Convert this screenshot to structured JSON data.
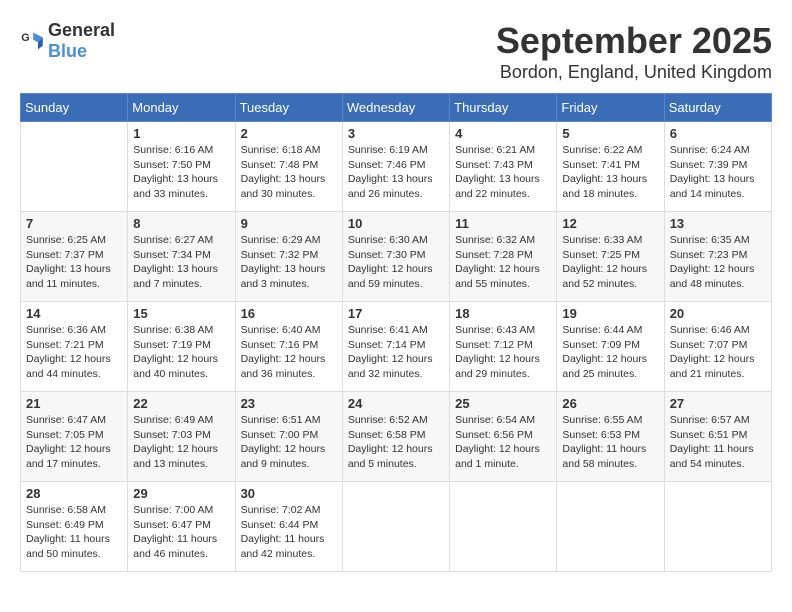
{
  "header": {
    "logo_general": "General",
    "logo_blue": "Blue",
    "month": "September 2025",
    "location": "Bordon, England, United Kingdom"
  },
  "days_of_week": [
    "Sunday",
    "Monday",
    "Tuesday",
    "Wednesday",
    "Thursday",
    "Friday",
    "Saturday"
  ],
  "weeks": [
    [
      {
        "day": "",
        "info": ""
      },
      {
        "day": "1",
        "info": "Sunrise: 6:16 AM\nSunset: 7:50 PM\nDaylight: 13 hours\nand 33 minutes."
      },
      {
        "day": "2",
        "info": "Sunrise: 6:18 AM\nSunset: 7:48 PM\nDaylight: 13 hours\nand 30 minutes."
      },
      {
        "day": "3",
        "info": "Sunrise: 6:19 AM\nSunset: 7:46 PM\nDaylight: 13 hours\nand 26 minutes."
      },
      {
        "day": "4",
        "info": "Sunrise: 6:21 AM\nSunset: 7:43 PM\nDaylight: 13 hours\nand 22 minutes."
      },
      {
        "day": "5",
        "info": "Sunrise: 6:22 AM\nSunset: 7:41 PM\nDaylight: 13 hours\nand 18 minutes."
      },
      {
        "day": "6",
        "info": "Sunrise: 6:24 AM\nSunset: 7:39 PM\nDaylight: 13 hours\nand 14 minutes."
      }
    ],
    [
      {
        "day": "7",
        "info": "Sunrise: 6:25 AM\nSunset: 7:37 PM\nDaylight: 13 hours\nand 11 minutes."
      },
      {
        "day": "8",
        "info": "Sunrise: 6:27 AM\nSunset: 7:34 PM\nDaylight: 13 hours\nand 7 minutes."
      },
      {
        "day": "9",
        "info": "Sunrise: 6:29 AM\nSunset: 7:32 PM\nDaylight: 13 hours\nand 3 minutes."
      },
      {
        "day": "10",
        "info": "Sunrise: 6:30 AM\nSunset: 7:30 PM\nDaylight: 12 hours\nand 59 minutes."
      },
      {
        "day": "11",
        "info": "Sunrise: 6:32 AM\nSunset: 7:28 PM\nDaylight: 12 hours\nand 55 minutes."
      },
      {
        "day": "12",
        "info": "Sunrise: 6:33 AM\nSunset: 7:25 PM\nDaylight: 12 hours\nand 52 minutes."
      },
      {
        "day": "13",
        "info": "Sunrise: 6:35 AM\nSunset: 7:23 PM\nDaylight: 12 hours\nand 48 minutes."
      }
    ],
    [
      {
        "day": "14",
        "info": "Sunrise: 6:36 AM\nSunset: 7:21 PM\nDaylight: 12 hours\nand 44 minutes."
      },
      {
        "day": "15",
        "info": "Sunrise: 6:38 AM\nSunset: 7:19 PM\nDaylight: 12 hours\nand 40 minutes."
      },
      {
        "day": "16",
        "info": "Sunrise: 6:40 AM\nSunset: 7:16 PM\nDaylight: 12 hours\nand 36 minutes."
      },
      {
        "day": "17",
        "info": "Sunrise: 6:41 AM\nSunset: 7:14 PM\nDaylight: 12 hours\nand 32 minutes."
      },
      {
        "day": "18",
        "info": "Sunrise: 6:43 AM\nSunset: 7:12 PM\nDaylight: 12 hours\nand 29 minutes."
      },
      {
        "day": "19",
        "info": "Sunrise: 6:44 AM\nSunset: 7:09 PM\nDaylight: 12 hours\nand 25 minutes."
      },
      {
        "day": "20",
        "info": "Sunrise: 6:46 AM\nSunset: 7:07 PM\nDaylight: 12 hours\nand 21 minutes."
      }
    ],
    [
      {
        "day": "21",
        "info": "Sunrise: 6:47 AM\nSunset: 7:05 PM\nDaylight: 12 hours\nand 17 minutes."
      },
      {
        "day": "22",
        "info": "Sunrise: 6:49 AM\nSunset: 7:03 PM\nDaylight: 12 hours\nand 13 minutes."
      },
      {
        "day": "23",
        "info": "Sunrise: 6:51 AM\nSunset: 7:00 PM\nDaylight: 12 hours\nand 9 minutes."
      },
      {
        "day": "24",
        "info": "Sunrise: 6:52 AM\nSunset: 6:58 PM\nDaylight: 12 hours\nand 5 minutes."
      },
      {
        "day": "25",
        "info": "Sunrise: 6:54 AM\nSunset: 6:56 PM\nDaylight: 12 hours\nand 1 minute."
      },
      {
        "day": "26",
        "info": "Sunrise: 6:55 AM\nSunset: 6:53 PM\nDaylight: 11 hours\nand 58 minutes."
      },
      {
        "day": "27",
        "info": "Sunrise: 6:57 AM\nSunset: 6:51 PM\nDaylight: 11 hours\nand 54 minutes."
      }
    ],
    [
      {
        "day": "28",
        "info": "Sunrise: 6:58 AM\nSunset: 6:49 PM\nDaylight: 11 hours\nand 50 minutes."
      },
      {
        "day": "29",
        "info": "Sunrise: 7:00 AM\nSunset: 6:47 PM\nDaylight: 11 hours\nand 46 minutes."
      },
      {
        "day": "30",
        "info": "Sunrise: 7:02 AM\nSunset: 6:44 PM\nDaylight: 11 hours\nand 42 minutes."
      },
      {
        "day": "",
        "info": ""
      },
      {
        "day": "",
        "info": ""
      },
      {
        "day": "",
        "info": ""
      },
      {
        "day": "",
        "info": ""
      }
    ]
  ]
}
